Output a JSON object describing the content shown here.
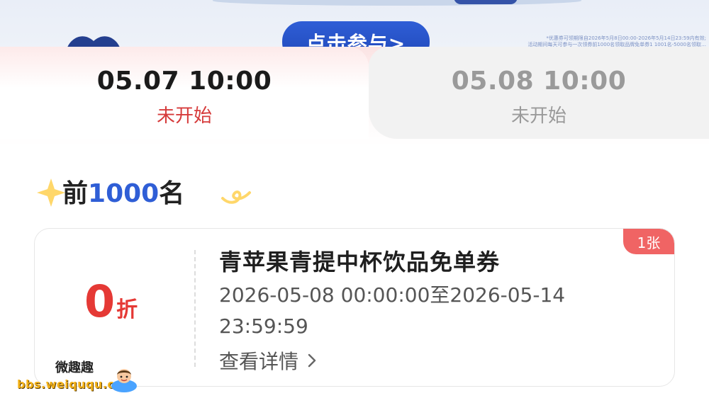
{
  "banner": {
    "join_button_label": "点击参与>",
    "fine_print_line1": "*优惠券可领期限自2026年5月8日00:00-2026年5月14日23:59内有效;",
    "fine_print_line2": "活动期间每天可参与一次领券前1000名领取品牌免单券1 1001名-5000名领取…",
    "accent_color": "#2f5ed6"
  },
  "tabs": [
    {
      "time": "05.07 10:00",
      "status": "未开始",
      "active": true
    },
    {
      "time": "05.08 10:00",
      "status": "未开始",
      "active": false
    }
  ],
  "section": {
    "title_prefix": "前",
    "title_number": "1000",
    "title_suffix": "名"
  },
  "coupon": {
    "discount_value": "0",
    "discount_unit": "折",
    "badge": "1张",
    "title": "青苹果青提中杯饮品免单券",
    "validity": "2026-05-08 00:00:00至2026-05-14 23:59:59",
    "details_link": "查看详情",
    "discount_color": "#e53935",
    "badge_color": "#f06464"
  },
  "watermark": {
    "name": "微趣趣",
    "url": "bbs.weiququ.cn"
  }
}
